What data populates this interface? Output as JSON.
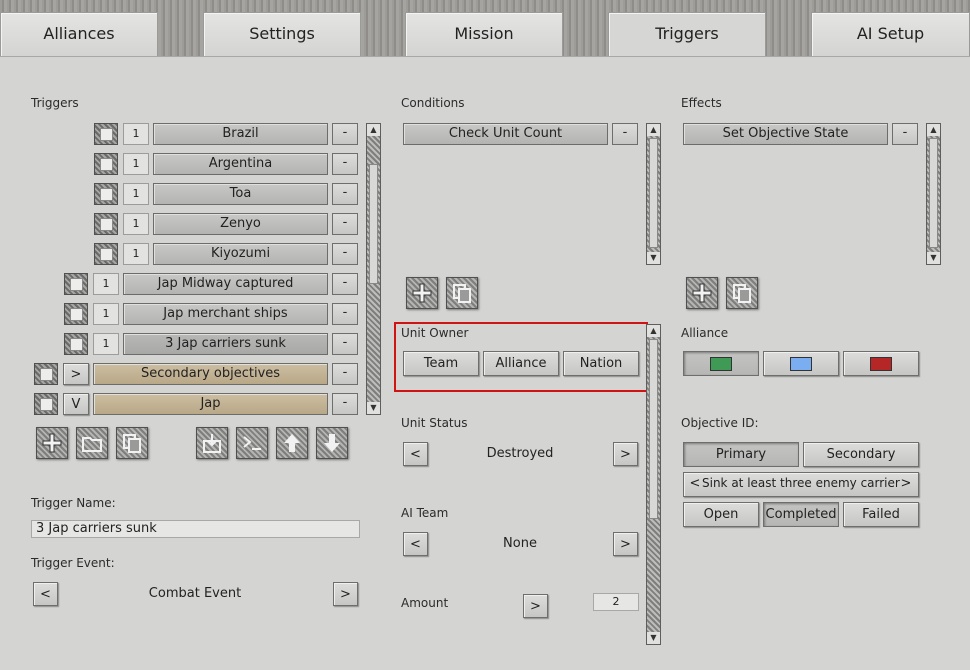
{
  "tabs": [
    {
      "label": "Alliances"
    },
    {
      "label": "Settings"
    },
    {
      "label": "Mission"
    },
    {
      "label": "Triggers",
      "active": true
    },
    {
      "label": "AI Setup"
    }
  ],
  "triggers": {
    "heading": "Triggers",
    "items": [
      {
        "num": "1",
        "name": "Brazil"
      },
      {
        "num": "1",
        "name": "Argentina"
      },
      {
        "num": "1",
        "name": "Toa"
      },
      {
        "num": "1",
        "name": "Zenyo"
      },
      {
        "num": "1",
        "name": "Kiyozumi"
      },
      {
        "num": "1",
        "name": "Jap Midway captured"
      },
      {
        "num": "1",
        "name": "Jap merchant ships"
      },
      {
        "num": "1",
        "name": "3 Jap carriers sunk"
      },
      {
        "toggle": ">",
        "name": "Secondary objectives"
      },
      {
        "toggle": "V",
        "name": "Jap"
      }
    ],
    "remove_label": "-",
    "trigger_name_label": "Trigger Name:",
    "trigger_name_value": "3 Jap carriers sunk",
    "trigger_event_label": "Trigger Event:",
    "trigger_event_value": "Combat Event",
    "prev": "<",
    "next": ">"
  },
  "conditions": {
    "heading": "Conditions",
    "items": [
      {
        "name": "Check Unit Count"
      }
    ],
    "remove_label": "-",
    "unit_owner_label": "Unit Owner",
    "owner_options": [
      "Team",
      "Alliance",
      "Nation"
    ],
    "unit_status_label": "Unit Status",
    "unit_status_value": "Destroyed",
    "ai_team_label": "AI Team",
    "ai_team_value": "None",
    "amount_label": "Amount",
    "amount_value": "2",
    "prev": "<",
    "next": ">"
  },
  "effects": {
    "heading": "Effects",
    "items": [
      {
        "name": "Set Objective State"
      }
    ],
    "remove_label": "-",
    "alliance_label": "Alliance",
    "alliance_colors": [
      "#3f9a55",
      "#7aaef0",
      "#b52727"
    ],
    "objective_id_label": "Objective ID:",
    "objective_types": [
      "Primary",
      "Secondary"
    ],
    "objective_text": "Sink at least three enemy carriers",
    "prev": "<",
    "next": ">",
    "states": [
      "Open",
      "Completed",
      "Failed"
    ]
  },
  "icons": {
    "add": "plus-icon",
    "folder": "folder-icon",
    "copy": "copy-icon",
    "import": "download-icon",
    "console": "console-icon",
    "move_up": "arrow-up-icon",
    "move_down": "arrow-down-icon"
  }
}
